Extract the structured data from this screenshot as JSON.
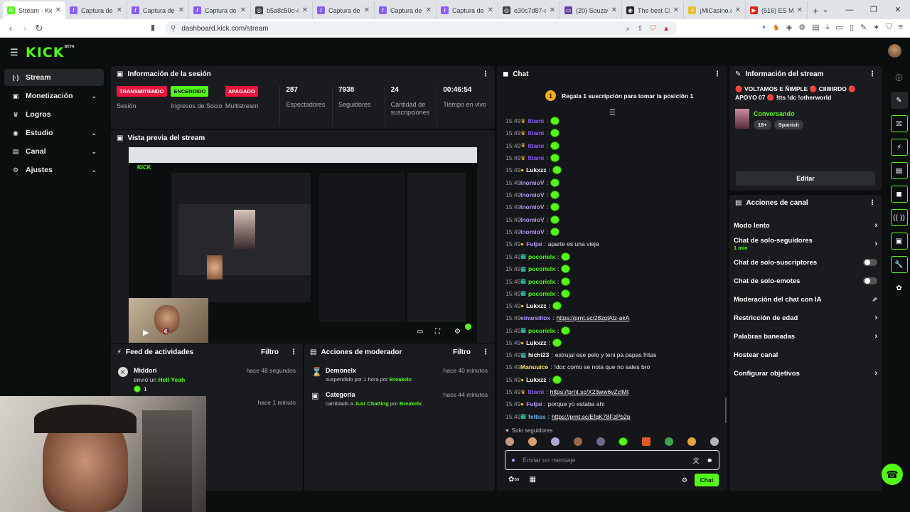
{
  "browser": {
    "tabs": [
      {
        "label": "Stream - Kick",
        "active": true,
        "fav": "K",
        "color": "#53fc18"
      },
      {
        "label": "Captura de pa",
        "fav": "/",
        "color": "#8d5cf6"
      },
      {
        "label": "Captura de pa",
        "fav": "/",
        "color": "#8d5cf6"
      },
      {
        "label": "Captura de pa",
        "fav": "/",
        "color": "#8d5cf6"
      },
      {
        "label": "b5a8c50c-4b3",
        "fav": "◎",
        "color": "#444"
      },
      {
        "label": "Captura de pa",
        "fav": "/",
        "color": "#8d5cf6"
      },
      {
        "label": "Captura de pa",
        "fav": "/",
        "color": "#8d5cf6"
      },
      {
        "label": "Captura de pa",
        "fav": "/",
        "color": "#8d5cf6"
      },
      {
        "label": "e30c7d87-d74",
        "fav": "◎",
        "color": "#444"
      },
      {
        "label": "(20) SouzaCar",
        "fav": "▭",
        "color": "#6441a5"
      },
      {
        "label": "The best Chat",
        "fav": "◉",
        "color": "#222"
      },
      {
        "label": "¡MiCasino.com",
        "fav": "◑",
        "color": "#e8c22a"
      },
      {
        "label": "(516) ES MUY",
        "fav": "▶",
        "color": "#e62117"
      }
    ],
    "url": "dashboard.kick.com/stream"
  },
  "sidebar": {
    "items": [
      {
        "label": "Stream",
        "icon": "(·)",
        "active": true
      },
      {
        "label": "Monetización",
        "icon": "▣",
        "chev": "⌄"
      },
      {
        "label": "Logros",
        "icon": "♛"
      },
      {
        "label": "Estudio",
        "icon": "◉",
        "chev": "⌄"
      },
      {
        "label": "Canal",
        "icon": "▤",
        "chev": "⌄"
      },
      {
        "label": "Ajustes",
        "icon": "⚙",
        "chev": "⌄"
      }
    ]
  },
  "session": {
    "title": "Información de la sesión",
    "badges": [
      {
        "badge": "TRANSMITIENDO",
        "label": "Sesión",
        "bg": "#e8163c",
        "fg": "#fff"
      },
      {
        "badge": "ENCENDIDO",
        "label": "Ingresos de Socio",
        "bg": "#53fc18",
        "fg": "#0b0e0f"
      },
      {
        "badge": "APAGADO",
        "label": "Multistream",
        "bg": "#e8163c",
        "fg": "#fff"
      }
    ],
    "stats": [
      {
        "num": "287",
        "label": "Espectadores"
      },
      {
        "num": "7938",
        "label": "Seguidores"
      },
      {
        "num": "24",
        "label": "Cantidad de suscripciones"
      },
      {
        "num": "00:46:54",
        "label": "Tiempo en vivo"
      }
    ]
  },
  "preview": {
    "title": "Vista previa del stream"
  },
  "feed": {
    "title": "Feed de actividades",
    "filter": "Filtro",
    "items": [
      {
        "user": "Middori",
        "text": "envió un",
        "item": "Hell Yeah",
        "time": "hace 48 segundos",
        "count": "1"
      },
      {
        "time": "hace 1 minuto"
      }
    ]
  },
  "modactions": {
    "title": "Acciones de moderador",
    "filter": "Filtro",
    "items": [
      {
        "user": "Demonelx",
        "text": "suspendido por 1 hora por",
        "by": "Breakelx",
        "time": "hace 40 minutos"
      },
      {
        "user": "Categoría",
        "text": "cambiado a",
        "cat": "Just Chatting",
        "by": "Breakelx",
        "time": "hace 44 minutos"
      }
    ]
  },
  "chat": {
    "title": "Chat",
    "pinned": "Regala 1 suscripción para tomar la posición 1",
    "pinned_rank": "1",
    "messages": [
      {
        "time": "15:49",
        "user": "Ittami",
        "color": "#8b5cf6",
        "badge": "crown",
        "msg": "",
        "emote": true
      },
      {
        "time": "15:49",
        "user": "Ittami",
        "color": "#8b5cf6",
        "badge": "crown",
        "msg": "",
        "emote": true
      },
      {
        "time": "15:49",
        "user": "Ittami",
        "color": "#8b5cf6",
        "badge": "crown",
        "msg": "",
        "emote": true
      },
      {
        "time": "15:49",
        "user": "Ittami",
        "color": "#8b5cf6",
        "badge": "crown",
        "msg": "",
        "emote": true
      },
      {
        "time": "15:49",
        "user": "Lukxzz",
        "color": "#fff",
        "badge": "sub",
        "msg": "",
        "emote": true
      },
      {
        "time": "15:49",
        "user": "lnomioV",
        "color": "#b794f4",
        "msg": "",
        "emote": true
      },
      {
        "time": "15:49",
        "user": "lnomioV",
        "color": "#b794f4",
        "msg": "",
        "emote": true
      },
      {
        "time": "15:49",
        "user": "lnomioV",
        "color": "#b794f4",
        "msg": "",
        "emote": true
      },
      {
        "time": "15:49",
        "user": "lnomioV",
        "color": "#b794f4",
        "msg": "",
        "emote": true
      },
      {
        "time": "15:49",
        "user": "lnomioV",
        "color": "#b794f4",
        "msg": "",
        "emote": true
      },
      {
        "time": "15:49",
        "user": "Fuljai",
        "color": "#b794f4",
        "badge": "sub",
        "msg": "aparte es una vieja"
      },
      {
        "time": "15:49",
        "user": "pocorielx",
        "color": "#53fc18",
        "badge": "mod",
        "msg": "",
        "emote": true
      },
      {
        "time": "15:49",
        "user": "pocorielx",
        "color": "#53fc18",
        "badge": "mod",
        "msg": "",
        "emote": true
      },
      {
        "time": "15:49",
        "user": "pocorielx",
        "color": "#53fc18",
        "badge": "mod",
        "msg": "",
        "emote": true
      },
      {
        "time": "15:49",
        "user": "pocorielx",
        "color": "#53fc18",
        "badge": "mod",
        "msg": "",
        "emote": true
      },
      {
        "time": "15:49",
        "user": "Lukxzz",
        "color": "#fff",
        "badge": "sub",
        "msg": "",
        "emote": true
      },
      {
        "time": "15:49",
        "user": "einarsillox",
        "color": "#b794f4",
        "msg": "https://prnt.sc/28zqlAlz-akA",
        "link": true
      },
      {
        "time": "15:49",
        "user": "pocorielx",
        "color": "#53fc18",
        "badge": "mod",
        "msg": "",
        "emote": true
      },
      {
        "time": "15:49",
        "user": "Lukxzz",
        "color": "#fff",
        "badge": "sub",
        "msg": "",
        "emote": true
      },
      {
        "time": "15:49",
        "user": "hichi23",
        "color": "#fff",
        "badge": "mod",
        "msg": "estrujal ese pelo y teni pa papas fritas"
      },
      {
        "time": "15:49",
        "user": "Manuuice",
        "color": "#f6e05e",
        "msg": "!doc como se nota que no sales bro"
      },
      {
        "time": "15:49",
        "user": "Lukxzz",
        "color": "#fff",
        "badge": "sub",
        "msg": "",
        "emote": true
      },
      {
        "time": "15:49",
        "user": "Ittami",
        "color": "#8b5cf6",
        "badge": "crown",
        "msg": "https://prnt.sc/X23ww6yZclMt",
        "link": true
      },
      {
        "time": "15:49",
        "user": "Fuljai",
        "color": "#b794f4",
        "badge": "sub",
        "msg": "porque yo estaba ahi"
      },
      {
        "time": "15:49",
        "user": "feltiss",
        "color": "#63b3ed",
        "badge": "mod",
        "msg": "https://prnt.sc/EfqK78FzPb2p",
        "link": true
      }
    ],
    "followers_only": "Solo seguidores",
    "input_placeholder": "Enviar un mensaje",
    "send_label": "Chat"
  },
  "streaminfo": {
    "title": "Información del stream",
    "stream_title": "🔴 VOLTAMOS E ÑIMPLE 🔴 CIIIIIIRDO 🔴 APOYO 07 🔴 !tts !dc !otherworld",
    "category": "Conversando",
    "tags": [
      "18+",
      "Spanish"
    ],
    "edit_label": "Editar"
  },
  "channelactions": {
    "title": "Acciones de canal",
    "items": [
      {
        "label": "Modo lento",
        "ctl": "chev"
      },
      {
        "label": "Chat de solo-seguidores",
        "sub": "1 min",
        "ctl": "chev"
      },
      {
        "label": "Chat de solo-suscriptores",
        "ctl": "toggle"
      },
      {
        "label": "Chat de solo-emotes",
        "ctl": "toggle"
      },
      {
        "label": "Moderación del chat con IA",
        "ctl": "ext"
      },
      {
        "label": "Restricción de edad",
        "ctl": "chev"
      },
      {
        "label": "Palabras baneadas",
        "ctl": "chev"
      },
      {
        "label": "Hostear canal",
        "ctl": "none"
      },
      {
        "label": "Configurar objetivos",
        "ctl": "chev"
      }
    ]
  },
  "colors": {
    "accent": "#53fc18",
    "red": "#e8163c",
    "panel": "#191b1f"
  }
}
